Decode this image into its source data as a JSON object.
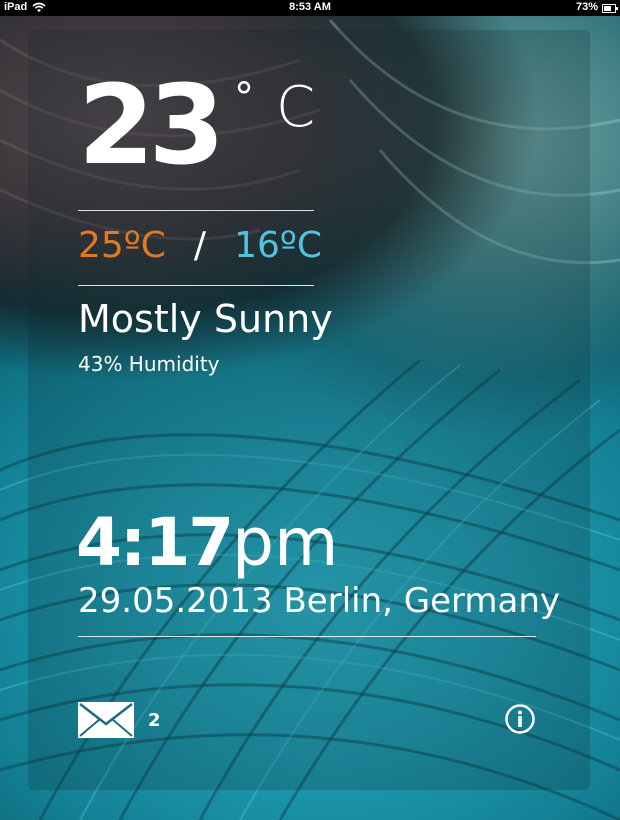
{
  "status_bar": {
    "device": "iPad",
    "time": "8:53 AM",
    "battery_percent": "73%",
    "battery_level": 0.73,
    "wifi_icon": "wifi-icon",
    "battery_icon": "battery-icon"
  },
  "weather": {
    "temperature": "23",
    "degree_symbol": "°",
    "unit": "C",
    "high": "25ºC",
    "separator": "/",
    "low": "16ºC",
    "condition": "Mostly Sunny",
    "humidity": "43% Humidity"
  },
  "clock": {
    "time": "4:17",
    "ampm": "pm",
    "date_location": "29.05.2013 Berlin, Germany"
  },
  "footer": {
    "mail_icon": "envelope-icon",
    "mail_count": "2",
    "info_icon": "info-icon"
  },
  "colors": {
    "high_temp": "#e07a23",
    "low_temp": "#4fc3e0",
    "text": "#ffffff"
  }
}
